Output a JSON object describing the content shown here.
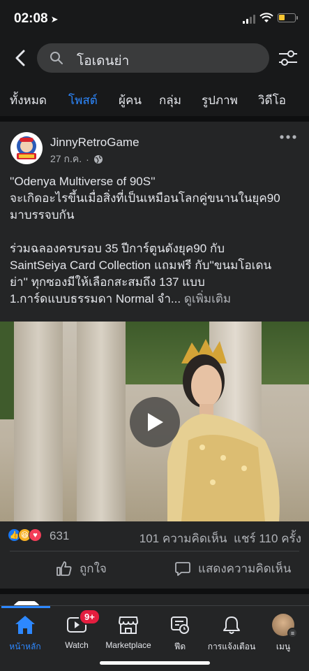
{
  "status": {
    "time": "02:08",
    "accent": "#f7c531"
  },
  "search": {
    "query": "โอเดนย่า"
  },
  "tabs": [
    {
      "label": "ทั้งหมด",
      "active": false
    },
    {
      "label": "โพสต์",
      "active": true
    },
    {
      "label": "ผู้คน",
      "active": false
    },
    {
      "label": "กลุ่ม",
      "active": false
    },
    {
      "label": "รูปภาพ",
      "active": false
    },
    {
      "label": "วิดีโอ",
      "active": false
    }
  ],
  "post": {
    "author": "JinnyRetroGame",
    "date": "27 ก.ค.",
    "text_line1": "''Odenya Multiverse of 90S''",
    "text_line2": "จะเกิดอะไรขึ้นเมื่อสิ่งที่เป็นเหมือนโลกคู่ขนานในยุค90",
    "text_line3": "มาบรรจบกัน",
    "text_line4": "ร่วมฉลองครบรอบ 35 ปีการ์ตูนดังยุค90 กับ",
    "text_line5": "SaintSeiya Card Collection แถมฟรี กับ''ขนมโอเดน",
    "text_line6": "ย่า'' ทุกซองมีให้เลือกสะสมถึง 137 แบบ",
    "text_line7": "1.การ์ดแบบธรรมดา Normal จำ...",
    "see_more": "ดูเพิ่มเติม",
    "reaction_count": "631",
    "comments": "101 ความคิดเห็น",
    "shares": "แชร์ 110 ครั้ง",
    "like_label": "ถูกใจ",
    "comment_label": "แสดงความคิดเห็น",
    "reaction_colors": {
      "like": "#1877f2",
      "haha": "#f7b125",
      "love": "#f33e58"
    }
  },
  "bottom_nav": {
    "home": "หน้าหลัก",
    "watch": "Watch",
    "watch_badge": "9+",
    "marketplace": "Marketplace",
    "feeds": "ฟีด",
    "notifications": "การแจ้งเตือน",
    "menu": "เมนู"
  },
  "colors": {
    "accent": "#2d88ff",
    "background": "#18191a",
    "card": "#242526"
  }
}
